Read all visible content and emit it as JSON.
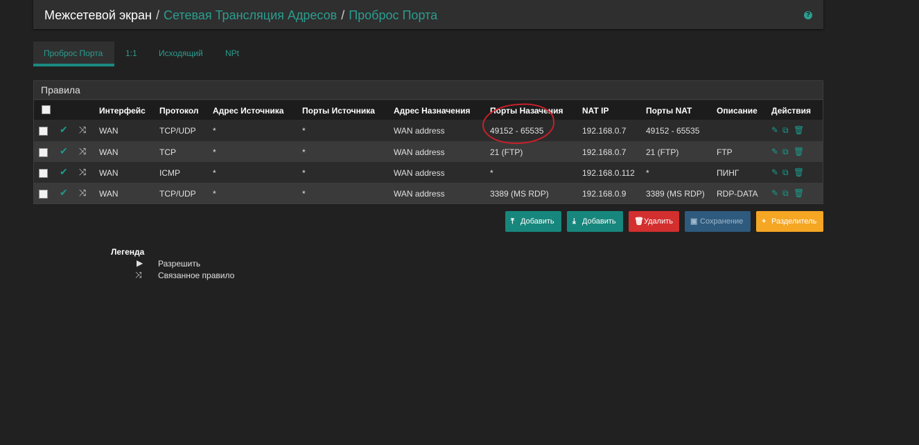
{
  "breadcrumb": {
    "root": "Межсетевой экран",
    "sep": "/",
    "level2": "Сетевая Трансляция Адресов",
    "level3": "Проброс Порта"
  },
  "help_icon": "question-icon",
  "tabs": [
    {
      "label": "Проброс Порта",
      "active": true
    },
    {
      "label": "1:1",
      "active": false
    },
    {
      "label": "Исходящий",
      "active": false
    },
    {
      "label": "NPt",
      "active": false
    }
  ],
  "panel": {
    "title": "Правила",
    "columns": [
      "Интерфейс",
      "Протокол",
      "Адрес Источника",
      "Порты Источника",
      "Адрес Назначения",
      "Порты Назачения",
      "NAT IP",
      "Порты NAT",
      "Описание",
      "Действия"
    ],
    "rows": [
      {
        "iface": "WAN",
        "proto": "TCP/UDP",
        "src": "*",
        "src_ports": "*",
        "dst": "WAN address",
        "dst_ports": "49152 - 65535",
        "nat_ip": "192.168.0.7",
        "nat_ports": "49152 - 65535",
        "desc": ""
      },
      {
        "iface": "WAN",
        "proto": "TCP",
        "src": "*",
        "src_ports": "*",
        "dst": "WAN address",
        "dst_ports": "21 (FTP)",
        "nat_ip": "192.168.0.7",
        "nat_ports": "21 (FTP)",
        "desc": "FTP"
      },
      {
        "iface": "WAN",
        "proto": "ICMP",
        "src": "*",
        "src_ports": "*",
        "dst": "WAN address",
        "dst_ports": "*",
        "nat_ip": "192.168.0.112",
        "nat_ports": "*",
        "desc": "ПИНГ"
      },
      {
        "iface": "WAN",
        "proto": "TCP/UDP",
        "src": "*",
        "src_ports": "*",
        "dst": "WAN address",
        "dst_ports": "3389 (MS RDP)",
        "nat_ip": "192.168.0.9",
        "nat_ports": "3389 (MS RDP)",
        "desc": "RDP-DATA"
      }
    ]
  },
  "buttons": {
    "add_top": "Добавить",
    "add_bottom": "Добавить",
    "delete": "Удалить",
    "save": "Сохранение",
    "separator": "Разделитель"
  },
  "legend": {
    "title": "Легенда",
    "allow": "Разрешить",
    "linked": "Связанное правило"
  },
  "colors": {
    "accent": "#2a9d8f",
    "button_teal": "#17877d",
    "button_red": "#d32f2f",
    "button_blue": "#2e5a7e",
    "button_orange": "#f5a623",
    "annotation_red": "#c8202a"
  }
}
